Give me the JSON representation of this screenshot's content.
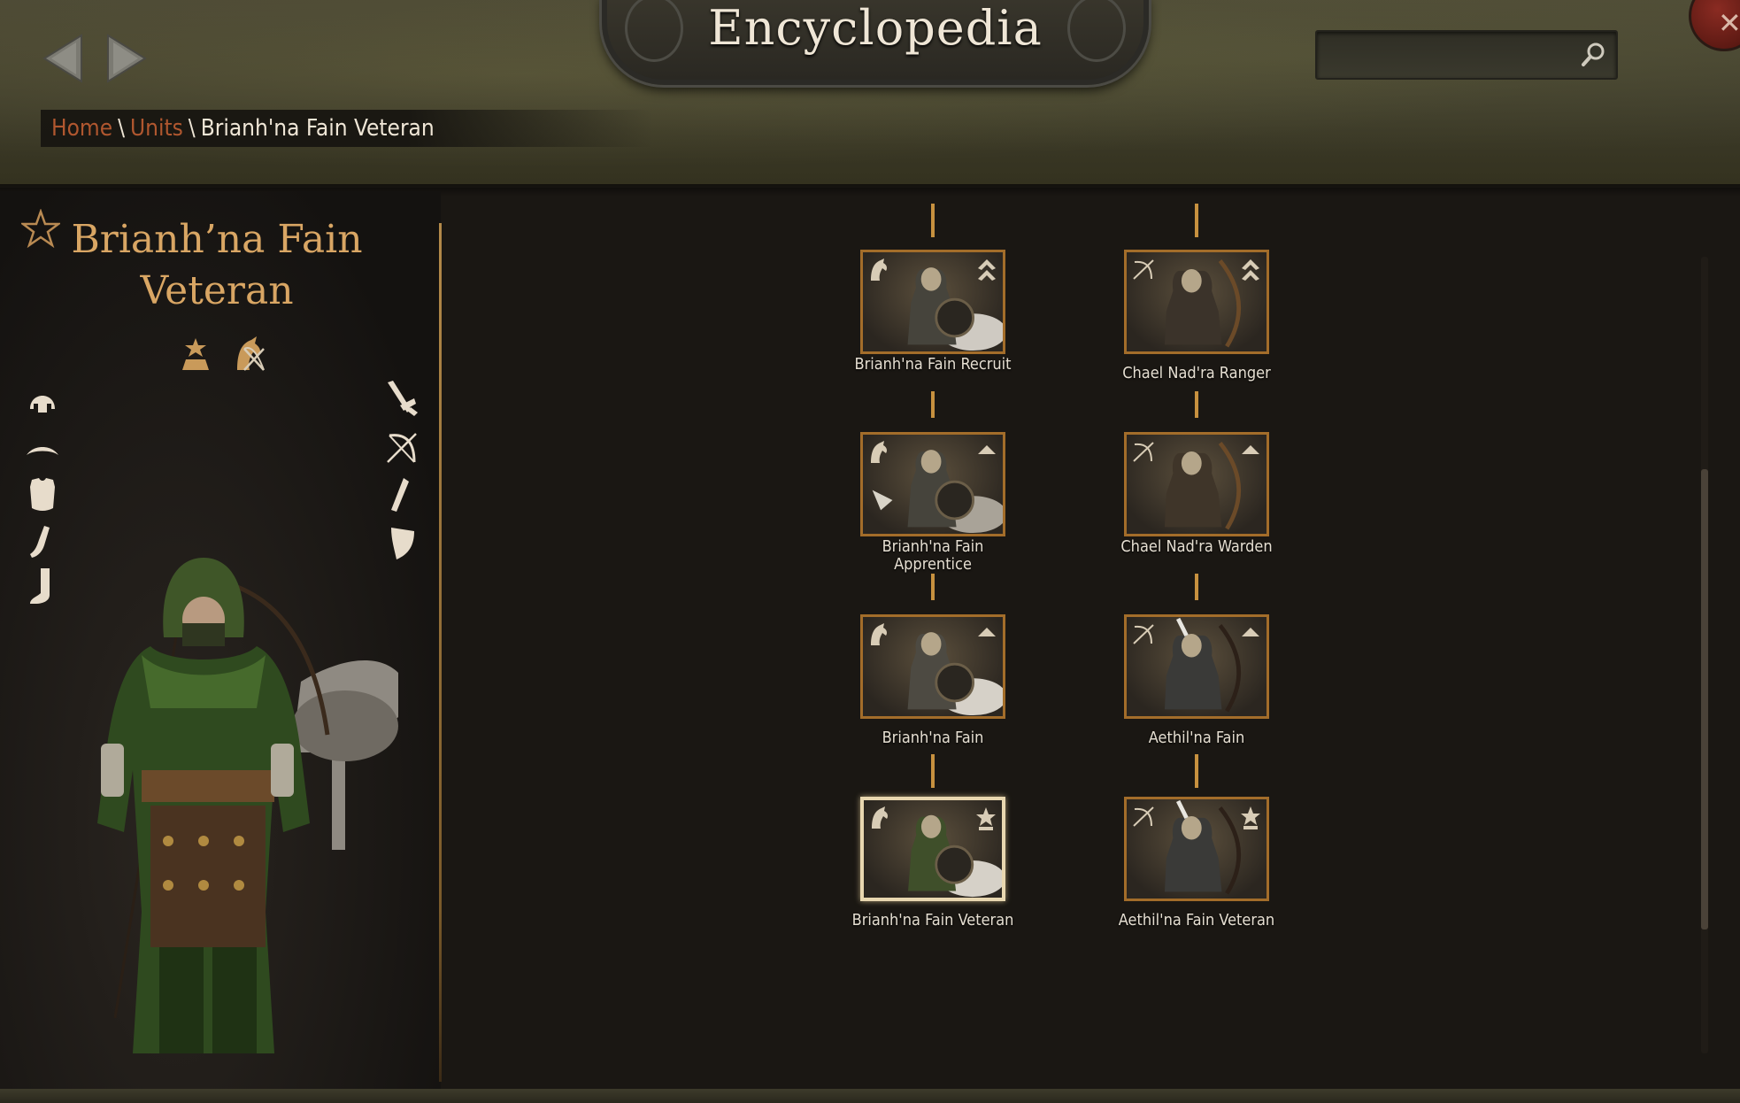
{
  "header": {
    "title": "Encyclopedia",
    "search_placeholder": "",
    "search_value": ""
  },
  "breadcrumb": {
    "home": "Home",
    "sep1": "\\",
    "units": "Units",
    "sep2": "\\",
    "current": "Brianh'na Fain Veteran"
  },
  "unit": {
    "name": "Brianh’na Fain Veteran",
    "tier_icon": "tier-star-icon",
    "class_icon": "horse-archer-icon",
    "equipment_left": [
      "helmet-icon",
      "cape-icon",
      "body-armor-icon",
      "gloves-icon",
      "boots-icon"
    ],
    "equipment_right": [
      "sword-icon",
      "bow-icon",
      "quiver-icon",
      "shield-icon"
    ]
  },
  "tree": {
    "left_column": [
      {
        "label": "Brianh'na Fain Recruit",
        "rank_icon": "double-chevron-icon",
        "selected": false
      },
      {
        "label": "Brianh'na Fain Apprentice",
        "rank_icon": "chevron-icon",
        "selected": false
      },
      {
        "label": "Brianh'na Fain",
        "rank_icon": "chevron-icon",
        "selected": false
      },
      {
        "label": "Brianh'na Fain Veteran",
        "rank_icon": "star-icon",
        "selected": true
      }
    ],
    "right_column": [
      {
        "label": "Chael Nad'ra Ranger",
        "rank_icon": "double-chevron-icon",
        "selected": false
      },
      {
        "label": "Chael Nad'ra Warden",
        "rank_icon": "chevron-icon",
        "selected": false
      },
      {
        "label": "Aethil'na Fain",
        "rank_icon": "chevron-icon",
        "selected": false
      },
      {
        "label": "Aethil'na Fain Veteran",
        "rank_icon": "star-icon",
        "selected": false
      }
    ]
  },
  "colors": {
    "accent_gold": "#d9a664",
    "link_red": "#b0572f",
    "connector": "#c7913f",
    "node_border": "#a36d2a",
    "node_selected_border": "#e8d7b0"
  }
}
